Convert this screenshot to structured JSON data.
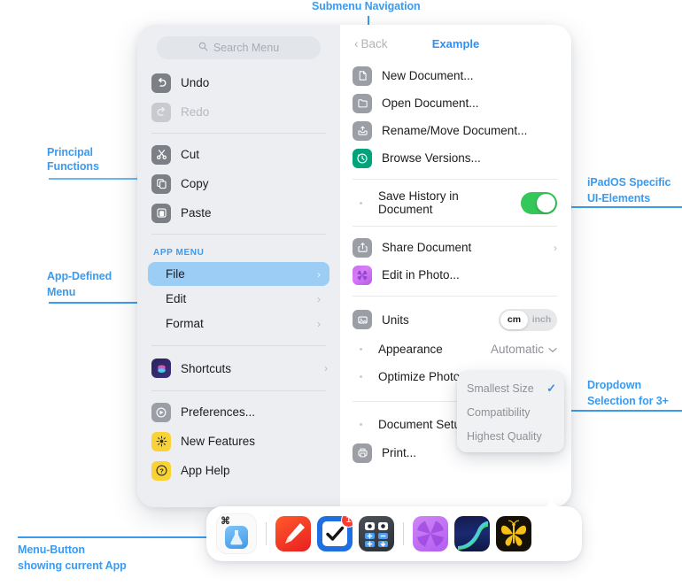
{
  "annotations": [
    {
      "id": "submenu-navigation",
      "text": "Submenu Navigation"
    },
    {
      "id": "principal-functions",
      "line1": "Principal",
      "line2": "Functions"
    },
    {
      "id": "app-defined-menu",
      "line1": "App-Defined",
      "line2": "Menu"
    },
    {
      "id": "ipados-specific",
      "line1": "iPadOS Specific",
      "line2": "UI-Elements"
    },
    {
      "id": "dropdown-selection",
      "line1": "Dropdown",
      "line2": "Selection for 3+"
    },
    {
      "id": "menu-button",
      "line1": "Menu-Button",
      "line2": "showing current App"
    }
  ],
  "colors": {
    "accent": "#2e90f5",
    "annotation": "#3a9bf0",
    "highlight_row": "#9ccdf5",
    "toggle_on": "#34c759",
    "badge": "#fc3b30",
    "left_panel_bg": "#eceef1",
    "right_panel_bg": "#ffffff"
  },
  "left_menu": {
    "search": {
      "placeholder": "Search Menu",
      "icon": "search-icon"
    },
    "group_edit_history": [
      {
        "label": "Undo",
        "icon": "undo-icon",
        "disabled": false
      },
      {
        "label": "Redo",
        "icon": "redo-icon",
        "disabled": true
      }
    ],
    "group_clipboard": [
      {
        "label": "Cut",
        "icon": "scissors-icon"
      },
      {
        "label": "Copy",
        "icon": "copy-icon"
      },
      {
        "label": "Paste",
        "icon": "paste-icon"
      }
    ],
    "app_menu_header": "APP MENU",
    "app_menu": [
      {
        "label": "File",
        "selected": true,
        "chevron": "chevron-right-icon"
      },
      {
        "label": "Edit",
        "selected": false,
        "chevron": "chevron-right-icon"
      },
      {
        "label": "Format",
        "selected": false,
        "chevron": "chevron-right-icon"
      }
    ],
    "group_shortcuts": [
      {
        "label": "Shortcuts",
        "icon": "shortcuts-icon",
        "chevron": "chevron-right-icon"
      }
    ],
    "group_help": [
      {
        "label": "Preferences...",
        "icon": "preferences-icon"
      },
      {
        "label": "New Features",
        "icon": "sparkle-icon"
      },
      {
        "label": "App Help",
        "icon": "question-mark-icon"
      }
    ]
  },
  "right_menu": {
    "back_label": "Back",
    "back_icon": "chevron-left-icon",
    "title": "Example",
    "group_documents": [
      {
        "label": "New Document...",
        "icon": "document-icon"
      },
      {
        "label": "Open Document...",
        "icon": "folder-icon"
      },
      {
        "label": "Rename/Move Document...",
        "icon": "rename-move-icon"
      },
      {
        "label": "Browse Versions...",
        "icon": "clock-arrow-icon"
      }
    ],
    "group_history": [
      {
        "label": "Save History in Document",
        "control": "toggle",
        "value": "on"
      }
    ],
    "group_share": [
      {
        "label": "Share Document",
        "icon": "share-icon",
        "chevron": "chevron-right-icon"
      },
      {
        "label": "Edit in Photo...",
        "icon": "photo-app-icon"
      }
    ],
    "group_settings": [
      {
        "label": "Units",
        "icon": "image-icon",
        "control": "segmented",
        "options": [
          "cm",
          "inch"
        ],
        "selected": "cm"
      },
      {
        "label": "Appearance",
        "control": "dropdown",
        "value": "Automatic",
        "chevron": "chevron-down-icon"
      },
      {
        "label": "Optimize Photos",
        "control": "dropdown"
      }
    ],
    "group_output": [
      {
        "label": "Document Setup"
      },
      {
        "label": "Print...",
        "icon": "printer-icon"
      }
    ]
  },
  "dropdown_popup": {
    "items": [
      {
        "label": "Smallest Size",
        "checked": true,
        "check_icon": "checkmark-icon"
      },
      {
        "label": "Compatibility",
        "checked": false
      },
      {
        "label": "Highest Quality",
        "checked": false
      }
    ]
  },
  "dock": {
    "menu_button": {
      "icon": "command-icon",
      "app_icon": "current-app-icon"
    },
    "apps": [
      {
        "name": "markup-app-icon",
        "badge": null
      },
      {
        "name": "tasks-app-icon",
        "badge": "1"
      },
      {
        "name": "calculator-app-icon",
        "badge": null
      },
      {
        "name": "affinity-photo-app-icon",
        "badge": null
      },
      {
        "name": "gradient-app-icon",
        "badge": null
      },
      {
        "name": "butterfly-app-icon",
        "badge": null
      }
    ]
  }
}
